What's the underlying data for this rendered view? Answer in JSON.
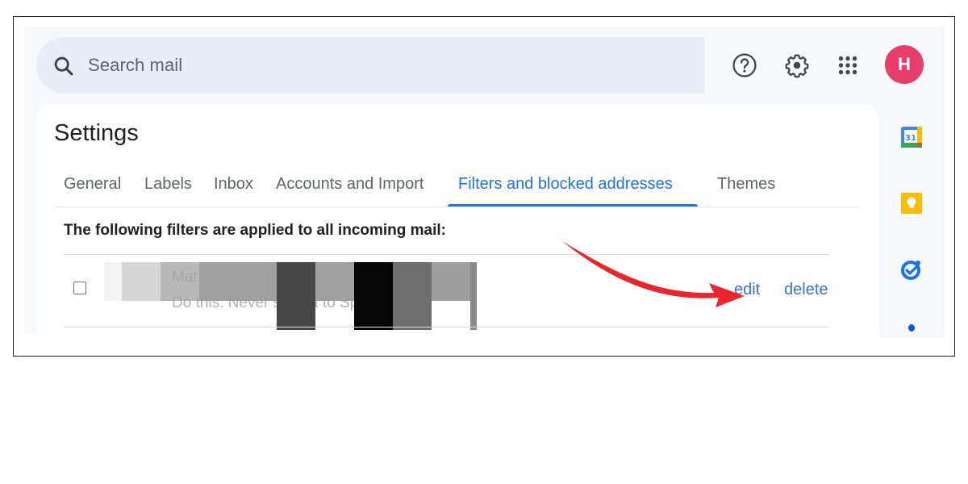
{
  "search": {
    "placeholder": "Search mail"
  },
  "header": {
    "icons": [
      "help-icon",
      "settings-gear-icon",
      "apps-grid-icon"
    ],
    "avatar_initial": "H",
    "avatar_color": "#e83e6c"
  },
  "settings": {
    "title": "Settings",
    "tabs": [
      {
        "label": "General",
        "active": false
      },
      {
        "label": "Labels",
        "active": false
      },
      {
        "label": "Inbox",
        "active": false
      },
      {
        "label": "Accounts and Import",
        "active": false
      },
      {
        "label": "Filters and blocked addresses",
        "active": true
      },
      {
        "label": "Themes",
        "active": false
      }
    ],
    "section_label": "The following filters are applied to all incoming mail:",
    "filters": [
      {
        "match_text": "Mat",
        "action_text": "Do this: Never send it to Spam",
        "redacted": true,
        "edit_label": "edit",
        "delete_label": "delete"
      }
    ]
  },
  "right_rail": {
    "apps": [
      {
        "name": "calendar",
        "label": "31"
      },
      {
        "name": "keep"
      },
      {
        "name": "tasks"
      }
    ]
  },
  "annotation": {
    "arrow_color": "#e8262c",
    "points_to": "edit"
  },
  "colors": {
    "accent": "#1a73e8",
    "link": "#3d6fd6",
    "search_bg": "#e9eef6",
    "app_bg": "#f6f8fc"
  }
}
